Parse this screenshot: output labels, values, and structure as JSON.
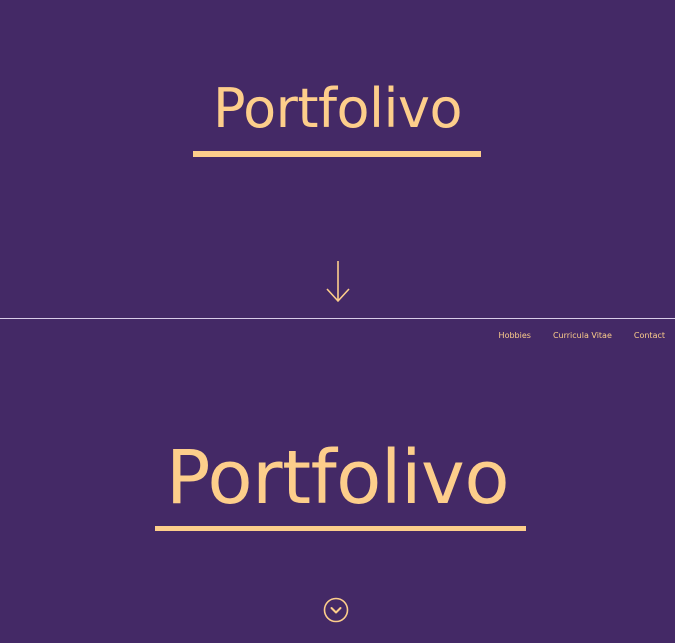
{
  "top_section": {
    "title": "Portfolivo",
    "scroll_icon": "arrow-down-icon"
  },
  "bottom_section": {
    "nav": {
      "items": [
        {
          "label": "Hobbies"
        },
        {
          "label": "Curricula Vitae"
        },
        {
          "label": "Contact"
        }
      ]
    },
    "title": "Portfolivo",
    "scroll_icon": "chevron-down-circle-icon"
  },
  "colors": {
    "background": "#442966",
    "accent": "#fdce8b",
    "divider": "#d9cce8"
  }
}
